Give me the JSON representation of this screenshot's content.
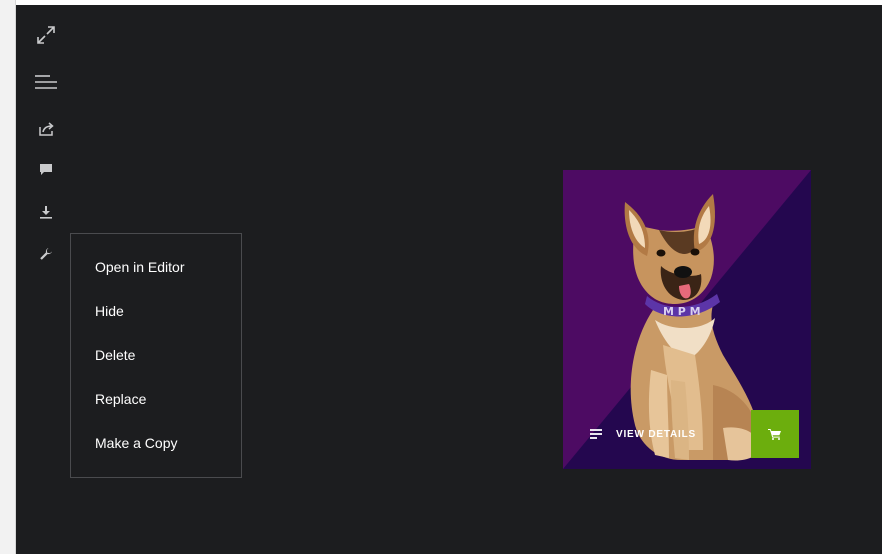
{
  "toolbar": {
    "icons": [
      "expand-icon",
      "menu-lines-icon",
      "share-icon",
      "comment-icon",
      "download-icon",
      "wrench-icon"
    ]
  },
  "context_menu": {
    "items": [
      "Open in Editor",
      "Hide",
      "Delete",
      "Replace",
      "Make a Copy"
    ]
  },
  "product_card": {
    "image_alt": "German shepherd illustration",
    "collar_text": "M P M",
    "details_label": "VIEW DETAILS",
    "cart_icon": "cart-icon"
  },
  "colors": {
    "app_bg": "#1c1d1f",
    "card_purple": "#4d0b63",
    "card_dark_purple": "#24074f",
    "cart_green": "#6cae0d"
  }
}
